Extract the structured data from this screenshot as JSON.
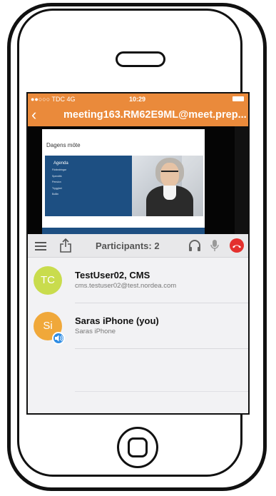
{
  "status_bar": {
    "carrier": "●●○○○ TDC  4G",
    "time": "10:29"
  },
  "nav": {
    "back_icon": "chevron-left-icon",
    "title": "meeting163.RM62E9ML@meet.prep..."
  },
  "slide": {
    "title": "Dagens möte",
    "agenda_title": "Agenda",
    "agenda_items": [
      "Förändringar",
      "Spendtik",
      "Pension",
      "Trygghet",
      "Bolån"
    ]
  },
  "toolbar": {
    "participants_label": "Participants: 2",
    "icons": [
      "menu-icon",
      "share-icon",
      "headphones-icon",
      "microphone-icon",
      "hang-up-icon"
    ],
    "hangup_color": "#e4302d"
  },
  "participants": [
    {
      "initials": "TC",
      "name": "TestUser02, CMS",
      "subtitle": "cms.testuser02@test.nordea.com",
      "avatar_color": "#c9dc4d"
    },
    {
      "initials": "Si",
      "name": "Saras iPhone (you)",
      "subtitle": "Saras iPhone",
      "avatar_color": "#f0a83a",
      "speaking": true
    }
  ],
  "colors": {
    "accent": "#ea8a3b",
    "speaker_badge": "#2f8de4"
  }
}
